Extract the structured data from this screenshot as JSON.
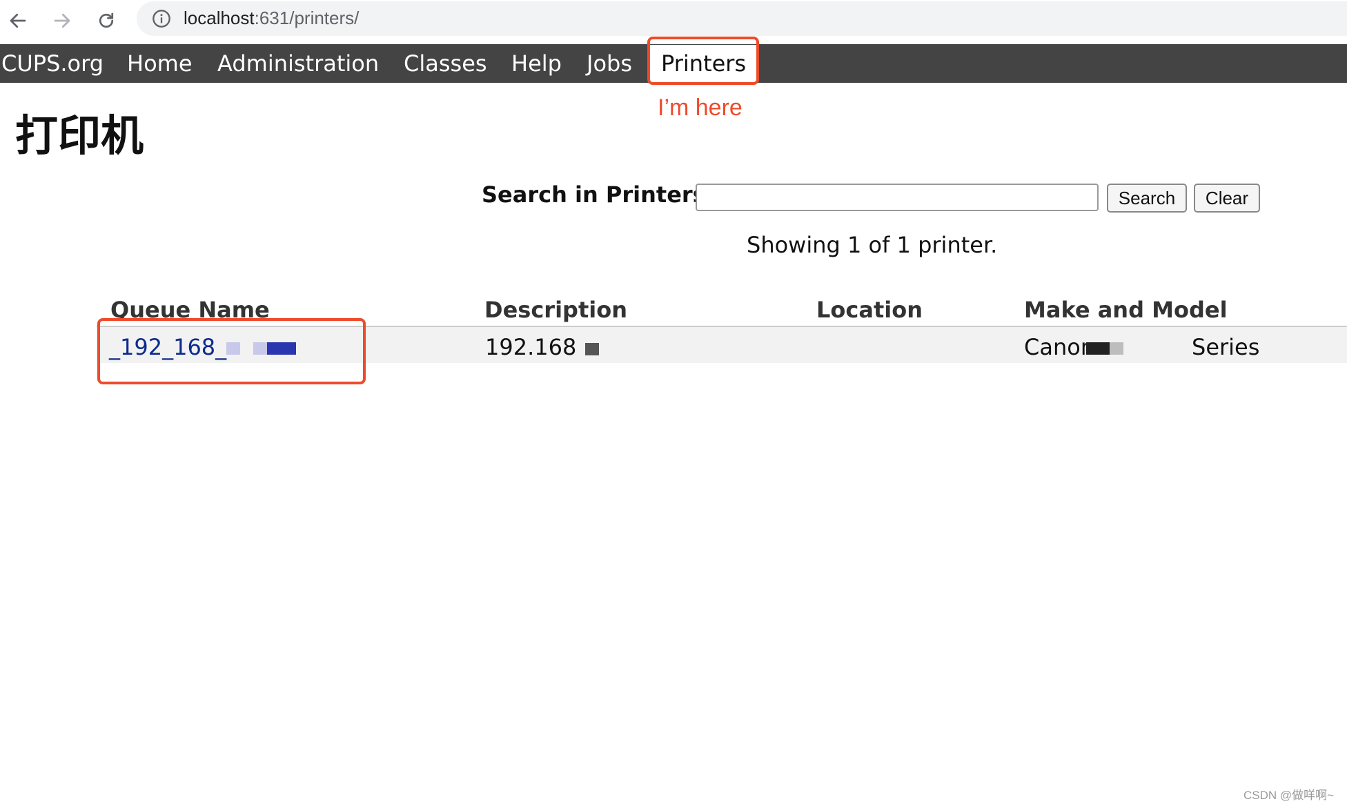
{
  "browser": {
    "url_host": "localhost",
    "url_path": ":631/printers/"
  },
  "nav": {
    "tabs": [
      {
        "label": "CUPS.org"
      },
      {
        "label": "Home"
      },
      {
        "label": "Administration"
      },
      {
        "label": "Classes"
      },
      {
        "label": "Help"
      },
      {
        "label": "Jobs"
      },
      {
        "label": "Printers",
        "active": true
      }
    ]
  },
  "annotation": {
    "text": "I’m here",
    "color": "#ee4b2b"
  },
  "page": {
    "title": "打印机"
  },
  "search": {
    "label": "Search in Printers:",
    "value": "",
    "search_button": "Search",
    "clear_button": "Clear"
  },
  "results": {
    "count_text": "Showing 1 of 1 printer."
  },
  "table": {
    "headers": [
      "Queue Name",
      "Description",
      "Location",
      "Make and Model"
    ],
    "rows": [
      {
        "queue_name": "_192_168_",
        "description": "192.168",
        "location": "",
        "make_model_prefix": "Canon",
        "make_model_suffix": "Series"
      }
    ]
  },
  "watermark": "CSDN @做咩啊~",
  "colors": {
    "nav_bg": "#444444",
    "link": "#0c2b8c",
    "highlight": "#ee4b2b"
  }
}
